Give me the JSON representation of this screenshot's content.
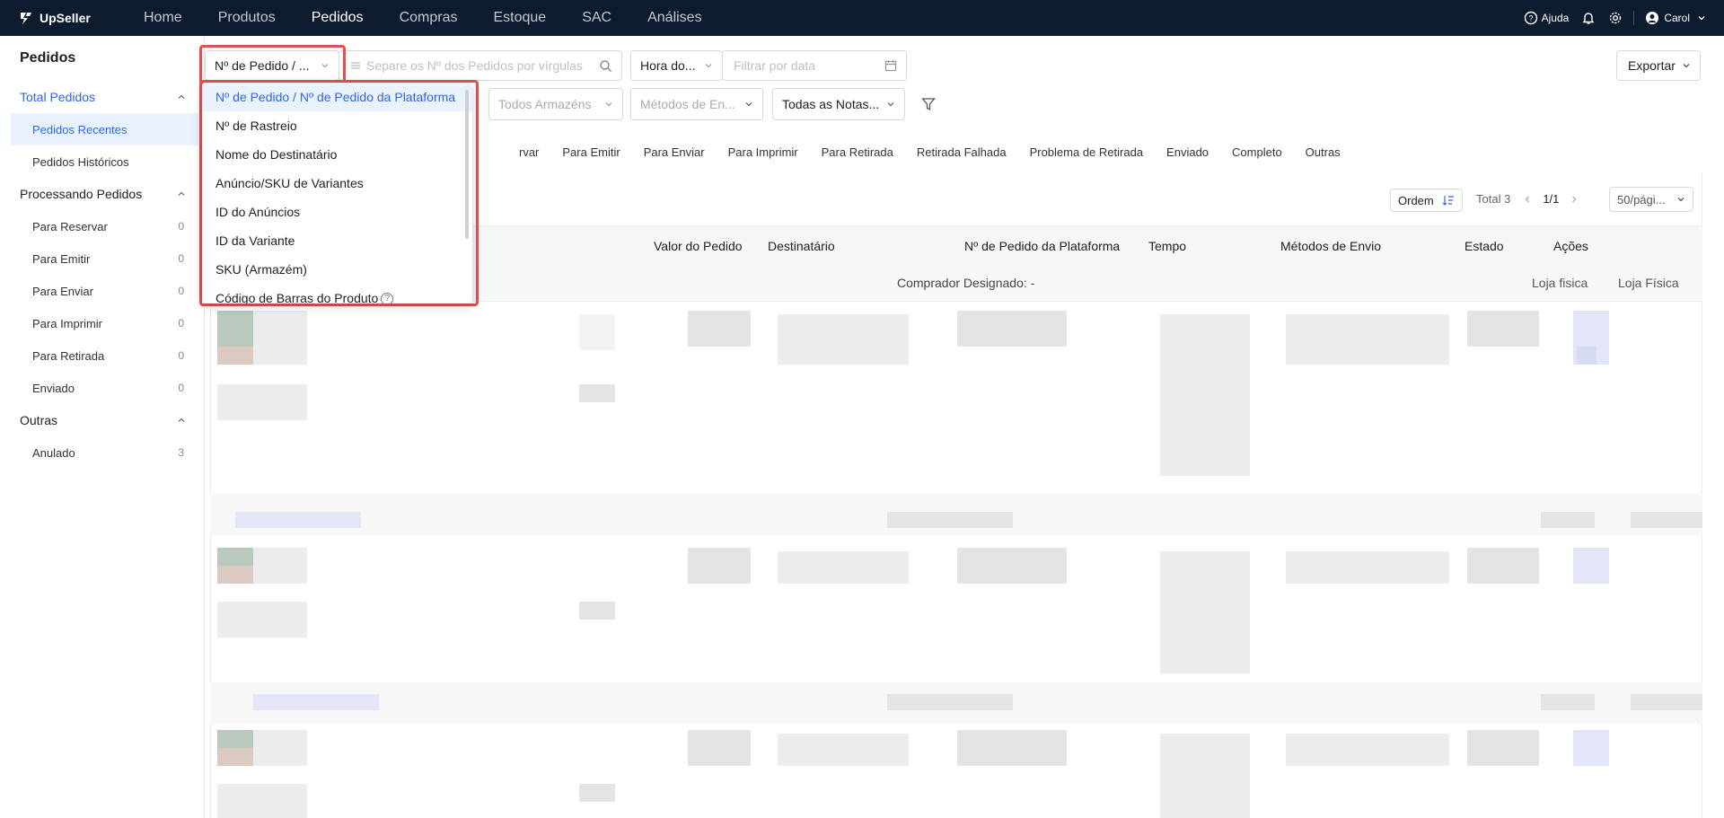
{
  "app": {
    "logo_text": "UpSeller"
  },
  "nav": {
    "items": [
      {
        "label": "Home"
      },
      {
        "label": "Produtos"
      },
      {
        "label": "Pedidos"
      },
      {
        "label": "Compras"
      },
      {
        "label": "Estoque"
      },
      {
        "label": "SAC"
      },
      {
        "label": "Análises"
      }
    ],
    "active_index": 2,
    "help_label": "Ajuda",
    "user_name": "Carol"
  },
  "sidebar": {
    "title": "Pedidos",
    "groups": [
      {
        "label": "Total Pedidos",
        "items": [
          {
            "label": "Pedidos Recentes",
            "count": ""
          },
          {
            "label": "Pedidos Históricos",
            "count": ""
          }
        ]
      },
      {
        "label": "Processando Pedidos",
        "items": [
          {
            "label": "Para Reservar",
            "count": "0"
          },
          {
            "label": "Para Emitir",
            "count": "0"
          },
          {
            "label": "Para Enviar",
            "count": "0"
          },
          {
            "label": "Para Imprimir",
            "count": "0"
          },
          {
            "label": "Para Retirada",
            "count": "0"
          },
          {
            "label": "Enviado",
            "count": "0"
          }
        ]
      },
      {
        "label": "Outras",
        "items": [
          {
            "label": "Anulado",
            "count": "3"
          }
        ]
      }
    ]
  },
  "filters": {
    "search_type": "Nº de Pedido / ...",
    "search_placeholder": "Separe os Nº dos Pedidos por vírgulas",
    "time_type": "Hora do...",
    "date_placeholder": "Filtrar por data",
    "export_label": "Exportar",
    "warehouses": "Todos Armazéns",
    "shipping_methods": "Métodos de En...",
    "notes": "Todas as Notas..."
  },
  "dropdown": {
    "options": [
      "Nº de Pedido / Nº de Pedido da Plataforma",
      "Nº de Rastreio",
      "Nome do Destinatário",
      "Anúncio/SKU de Variantes",
      "ID do Anúncios",
      "ID da Variante",
      "SKU (Armazém)",
      "Código de Barras do Produto"
    ],
    "selected_index": 0
  },
  "status_tabs": {
    "first_partial": "rvar",
    "items": [
      "Para Emitir",
      "Para Enviar",
      "Para Imprimir",
      "Para Retirada",
      "Retirada Falhada",
      "Problema de Retirada",
      "Enviado",
      "Completo",
      "Outras"
    ]
  },
  "toolbar": {
    "order_label": "Ordem",
    "total": "Total 3",
    "page": "1/1",
    "page_size": "50/pági..."
  },
  "table": {
    "columns": [
      "Valor do Pedido",
      "Destinatário",
      "Nº de Pedido da Plataforma",
      "Tempo",
      "Métodos de Envio",
      "Estado",
      "Ações"
    ],
    "subrow": {
      "buyer": "Comprador Designado: -",
      "store1": "Loja fisica",
      "store2": "Loja Física"
    }
  },
  "colors": {
    "nav_bg": "#0d1b2e",
    "accent": "#2a68e8",
    "highlight": "#e05252"
  }
}
